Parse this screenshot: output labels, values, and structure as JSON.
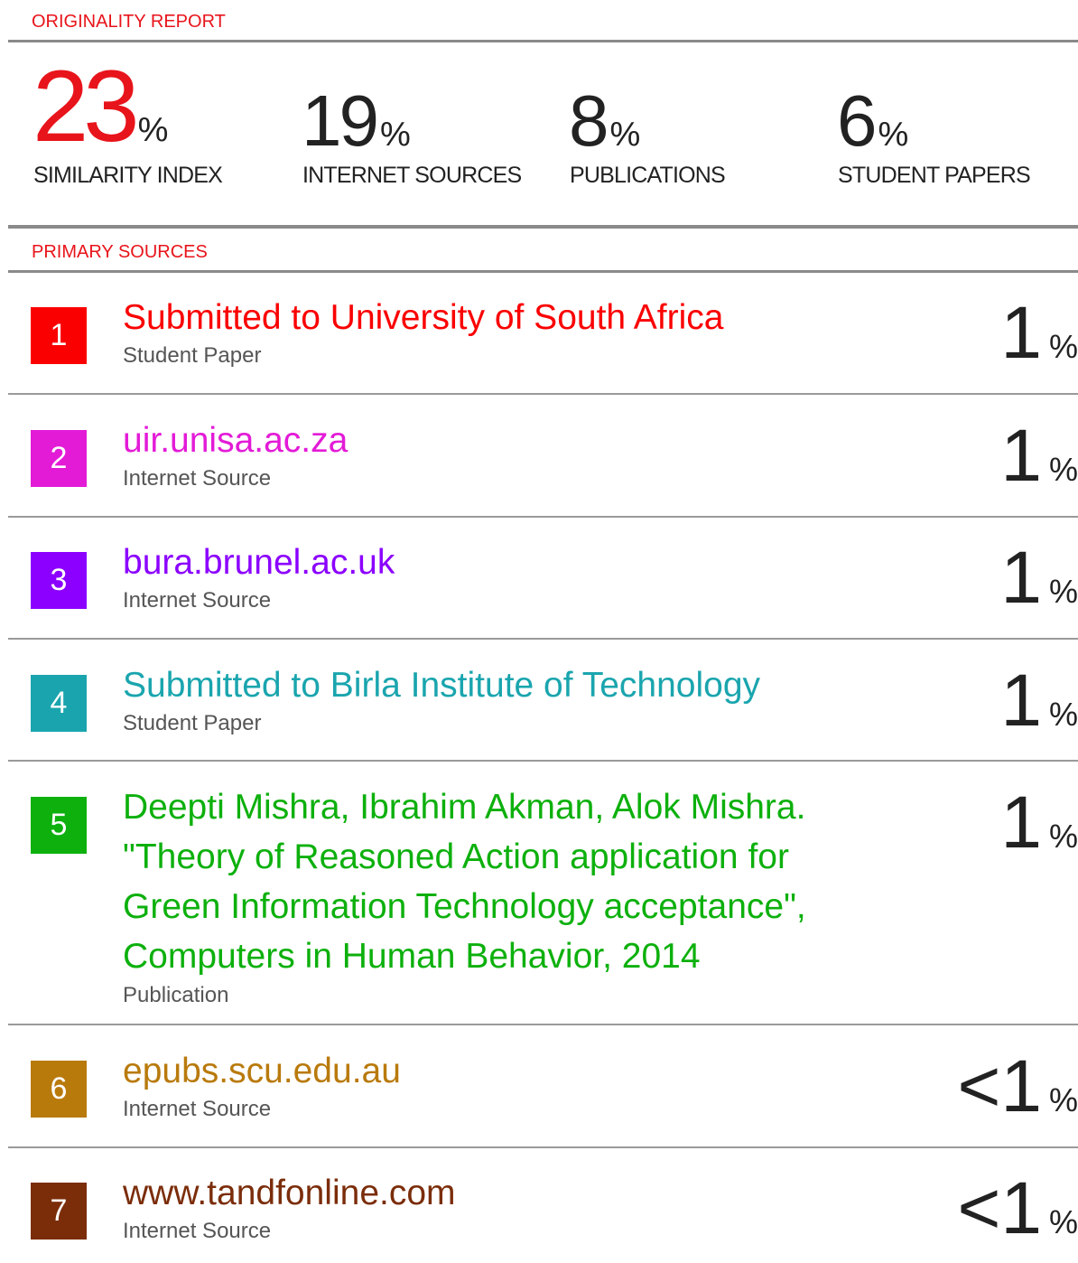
{
  "report_title": "ORIGINALITY REPORT",
  "stats": [
    {
      "value": "23",
      "unit": "%",
      "label": "SIMILARITY INDEX"
    },
    {
      "value": "19",
      "unit": "%",
      "label": "INTERNET SOURCES"
    },
    {
      "value": "8",
      "unit": "%",
      "label": "PUBLICATIONS"
    },
    {
      "value": "6",
      "unit": "%",
      "label": "STUDENT PAPERS"
    }
  ],
  "primary_sources_label": "PRIMARY SOURCES",
  "sources": [
    {
      "rank": "1",
      "title": "Submitted to University of South Africa",
      "type": "Student Paper",
      "share": "1",
      "unit": "%",
      "color": "#fa0000"
    },
    {
      "rank": "2",
      "title": "uir.unisa.ac.za",
      "type": "Internet Source",
      "share": "1",
      "unit": "%",
      "color": "#e31bd7"
    },
    {
      "rank": "3",
      "title": "bura.brunel.ac.uk",
      "type": "Internet Source",
      "share": "1",
      "unit": "%",
      "color": "#8b00ff"
    },
    {
      "rank": "4",
      "title": "Submitted to Birla Institute of Technology",
      "type": "Student Paper",
      "share": "1",
      "unit": "%",
      "color": "#1aa5ae"
    },
    {
      "rank": "5",
      "title": "Deepti Mishra, Ibrahim Akman, Alok Mishra. \"Theory of Reasoned Action application for Green Information Technology acceptance\", Computers in Human Behavior, 2014",
      "type": "Publication",
      "share": "1",
      "unit": "%",
      "color": "#0db00d"
    },
    {
      "rank": "6",
      "title": "epubs.scu.edu.au",
      "type": "Internet Source",
      "share": "<1",
      "unit": "%",
      "color": "#b97a0c"
    },
    {
      "rank": "7",
      "title": "www.tandfonline.com",
      "type": "Internet Source",
      "share": "<1",
      "unit": "%",
      "color": "#7b2d0a"
    }
  ]
}
